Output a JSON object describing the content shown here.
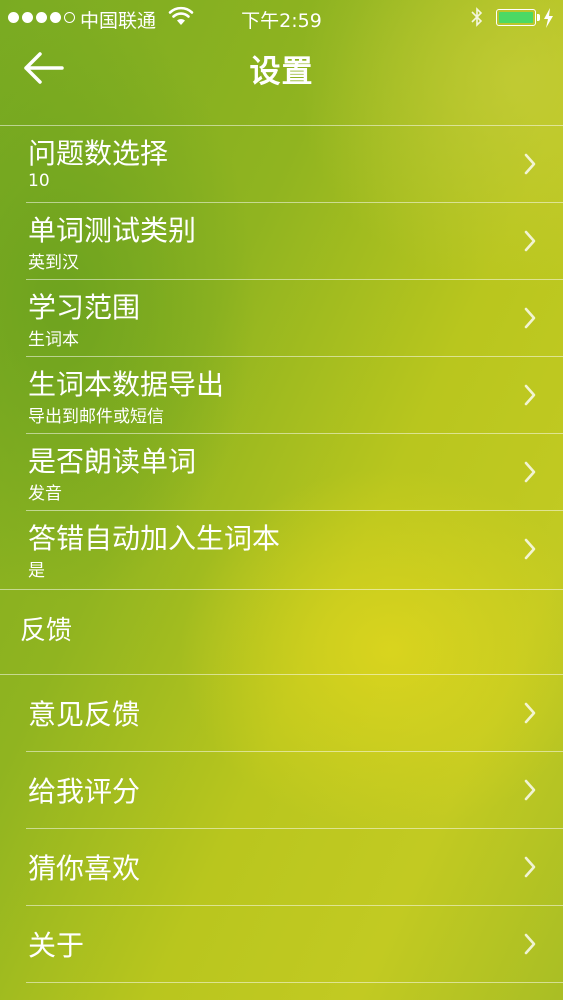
{
  "status_bar": {
    "carrier": "中国联通",
    "time": "下午2:59",
    "battery_level": 1.0,
    "battery_color": "#4cd964"
  },
  "nav": {
    "title": "设置",
    "back_icon": "arrow-left-icon"
  },
  "settings": [
    {
      "title": "问题数选择",
      "value": "10"
    },
    {
      "title": "单词测试类别",
      "value": "英到汉"
    },
    {
      "title": "学习范围",
      "value": "生词本"
    },
    {
      "title": "生词本数据导出",
      "value": "导出到邮件或短信"
    },
    {
      "title": "是否朗读单词",
      "value": "发音"
    },
    {
      "title": "答错自动加入生词本",
      "value": "是"
    }
  ],
  "feedback_section": {
    "header": "反馈",
    "items": [
      {
        "title": "意见反馈"
      },
      {
        "title": "给我评分"
      },
      {
        "title": "猜你喜欢"
      },
      {
        "title": "关于"
      }
    ]
  },
  "colors": {
    "text": "#ffffff",
    "background_green": "#7aab22",
    "background_yellow": "#d6d21e"
  }
}
